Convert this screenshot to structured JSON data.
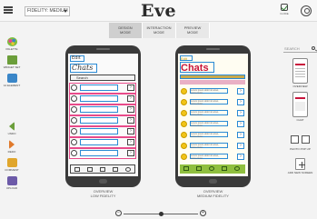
{
  "app": {
    "logo": "Eve"
  },
  "fidelity": {
    "label": "FIDELITY: MEDIUM"
  },
  "modes": [
    {
      "line1": "DESIGN",
      "line2": "MODE",
      "active": true
    },
    {
      "line1": "INTERACTION",
      "line2": "MODE",
      "active": false
    },
    {
      "line1": "PREVIEW",
      "line2": "MODE",
      "active": false
    }
  ],
  "guide": {
    "label": "GUIDE"
  },
  "left_tools": [
    {
      "label": "PALETTE",
      "icon": "palette-icon",
      "color": "#d94b8b"
    },
    {
      "label": "WIDGET SET",
      "icon": "widget-set-icon",
      "color": "#6b9e3a"
    },
    {
      "label": "12 ELEMENT",
      "icon": "element-icon",
      "color": "#3a86c8"
    },
    {
      "label": "UNDO",
      "icon": "undo-icon",
      "color": "#6b9e3a"
    },
    {
      "label": "REDO",
      "icon": "redo-icon",
      "color": "#e07a2c"
    },
    {
      "label": "COMMENT",
      "icon": "comment-icon",
      "color": "#e0a62c"
    },
    {
      "label": "UPLOAD",
      "icon": "upload-icon",
      "color": "#6c5aa8"
    }
  ],
  "phone_left": {
    "edit_label": "Edit",
    "title": "Chats",
    "search_label": "Search",
    "caption1": "OVERVIEW",
    "caption2": "LOW FIDELITY"
  },
  "phone_right": {
    "edit_label": "Edit",
    "title": "Chats",
    "row_text": "Lorem ipsum dolor sit amet, consectetur.",
    "caption1": "OVERVIEW",
    "caption2": "MEDIUM FIDELITY"
  },
  "right_panel": {
    "search_placeholder": "SEARCH",
    "cards": [
      {
        "label": "OVERVIEW"
      },
      {
        "label": "CHAT"
      },
      {
        "label": "PHOTO POP UP"
      },
      {
        "label": "ADD NEW SCREEN"
      }
    ]
  }
}
